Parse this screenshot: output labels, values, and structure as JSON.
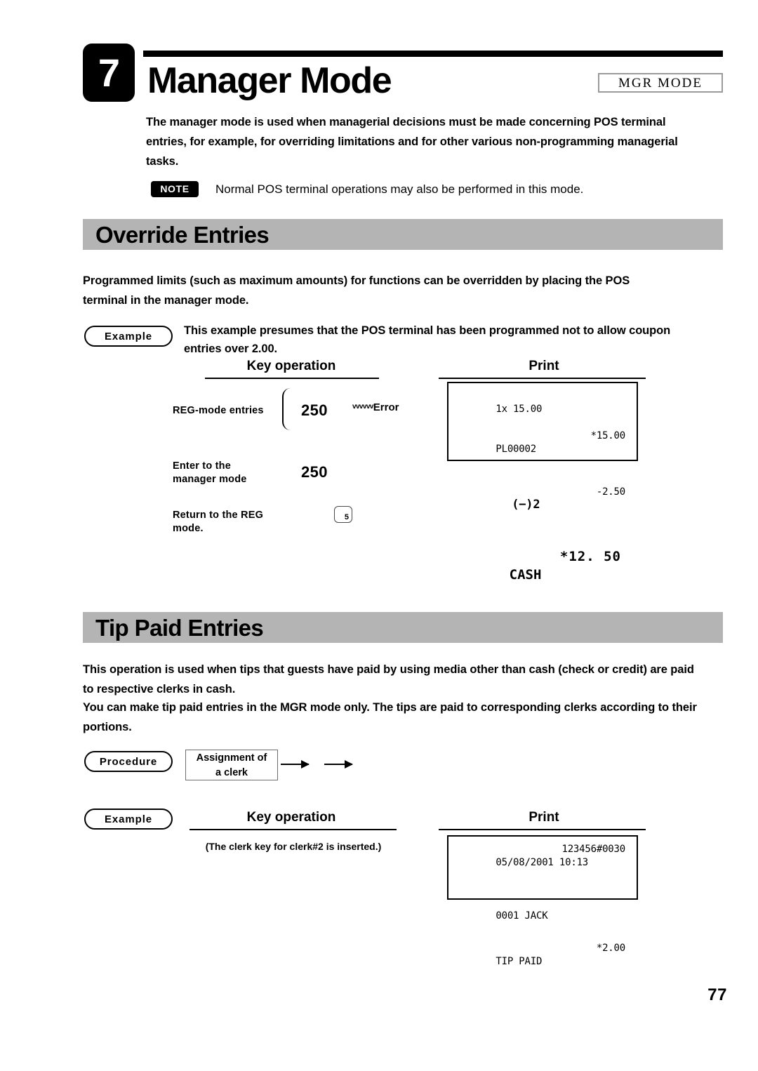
{
  "header": {
    "chapter_number": "7",
    "title": "Manager Mode",
    "mode_badge": "MGR MODE"
  },
  "intro": {
    "paragraph": "The manager mode is used when managerial decisions must be made concerning POS terminal entries, for example, for overriding limitations and for other various non-programming managerial tasks."
  },
  "note": {
    "tag": "NOTE",
    "text": "Normal POS terminal operations may also be performed in this mode."
  },
  "sections": [
    {
      "title": "Override Entries",
      "paragraph": "Programmed limits (such as maximum amounts) for functions can be overridden by placing the POS terminal in the manager mode.",
      "example": {
        "badge": "Example",
        "text": "This example presumes that the POS terminal has been programmed not to allow coupon entries over 2.00.",
        "col_key_operation": "Key operation",
        "col_print": "Print",
        "rows": [
          {
            "label": "REG-mode entries",
            "value": "250",
            "buzz": "vvvvvv",
            "error": "Error"
          },
          {
            "label": "Enter to the\nmanager mode",
            "value": "250"
          },
          {
            "label": "Return to the REG\nmode.",
            "key": "5"
          }
        ],
        "receipt": {
          "line1_left": "1x 15.00",
          "line2_left": "PL00002",
          "line2_right": "*15.00",
          "line3_left": "(−)2",
          "line3_right": "-2.50",
          "line4_left": "CASH",
          "line4_right": "*12. 50"
        }
      }
    },
    {
      "title": "Tip Paid Entries",
      "paragraph_a": "This operation is used when tips that guests have paid by using media other than cash (check or credit) are paid to respective clerks in cash.",
      "paragraph_b": "You can make tip paid entries in the MGR mode only. The tips are paid to corresponding clerks according to their portions.",
      "procedure": {
        "badge": "Procedure",
        "step1": "Assignment of\na clerk"
      },
      "example": {
        "badge": "Example",
        "col_key_operation": "Key operation",
        "col_print": "Print",
        "note": "(The clerk key for clerk#2 is inserted.)",
        "receipt": {
          "line1_left": "05/08/2001 10:13",
          "line1_right": "123456#0030",
          "line2_left": "0001 JACK",
          "line3_left": "TIP PAID",
          "line3_right": "*2.00"
        }
      }
    }
  ],
  "footer": {
    "page_number": "77"
  },
  "colors": {
    "section_bar": "#b4b4b4",
    "ink": "#000000",
    "paper": "#ffffff"
  }
}
